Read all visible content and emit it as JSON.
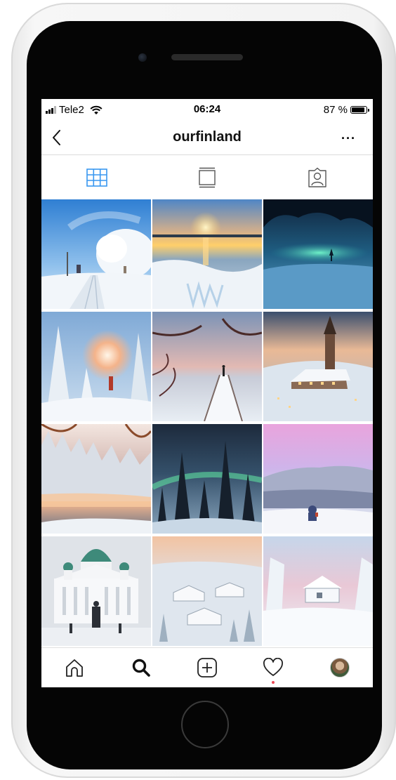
{
  "status_bar": {
    "carrier": "Tele2",
    "time": "06:24",
    "battery": "87 %",
    "battery_level": 0.87,
    "icons": [
      "signal-icon",
      "wifi-icon",
      "battery-icon"
    ]
  },
  "header": {
    "title": "ourfinland",
    "back_icon": "chevron-left-icon",
    "more_icon": "more-horizontal-icon",
    "more_label": "···"
  },
  "tabs": [
    {
      "name": "grid-view",
      "icon": "grid-icon",
      "active": true,
      "color": "#3897f0"
    },
    {
      "name": "feed-view",
      "icon": "feed-icon",
      "active": false
    },
    {
      "name": "tagged-view",
      "icon": "tagged-person-icon",
      "active": false
    }
  ],
  "posts": [
    {
      "subject": "frosted tree on snowy road"
    },
    {
      "subject": "sunset over frozen sea"
    },
    {
      "subject": "aurora inside ice cave"
    },
    {
      "subject": "sun behind snowy spruces"
    },
    {
      "subject": "person on snowy pier at dusk"
    },
    {
      "subject": "church in snowy town"
    },
    {
      "subject": "misty lake with frosted forest"
    },
    {
      "subject": "aurora over spruce forest"
    },
    {
      "subject": "pink sky over fell"
    },
    {
      "subject": "Helsinki cathedral"
    },
    {
      "subject": "snowy village at sunset"
    },
    {
      "subject": "snow-covered cabin"
    }
  ],
  "bottom_nav": [
    {
      "name": "home",
      "icon": "home-icon"
    },
    {
      "name": "search",
      "icon": "search-icon",
      "active": true
    },
    {
      "name": "new-post",
      "icon": "add-post-icon"
    },
    {
      "name": "activity",
      "icon": "heart-icon",
      "notification": true
    },
    {
      "name": "profile",
      "icon": "avatar"
    }
  ],
  "colors": {
    "accent": "#3897f0",
    "notification": "#ed4956",
    "divider": "#dbdbdb"
  }
}
